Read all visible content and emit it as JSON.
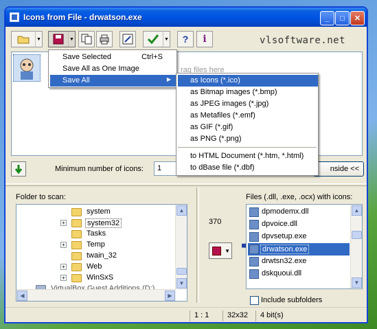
{
  "window": {
    "title": "Icons from File - drwatson.exe",
    "min_glyph": "_",
    "max_glyph": "□",
    "close_glyph": "✕"
  },
  "toolbar": {
    "open_icon": "folder-open-icon",
    "save_icon": "floppy-save-icon",
    "copy_icon": "copy-icon",
    "print_icon": "printer-icon",
    "edit_icon": "edit-icon",
    "select_icon": "checkmark-icon",
    "help_label": "?",
    "info_label": "i",
    "brand": "vlsoftware.net"
  },
  "preview": {
    "hint": "rag files here"
  },
  "controls": {
    "min_icons_label": "Minimum number of icons:",
    "min_icons_value": "1",
    "inside_label": "nside <<"
  },
  "folder_pane": {
    "label": "Folder to scan:",
    "items": [
      {
        "label": "system",
        "expandable": false,
        "selected": false
      },
      {
        "label": "system32",
        "expandable": true,
        "selected": true
      },
      {
        "label": "Tasks",
        "expandable": false,
        "selected": false
      },
      {
        "label": "Temp",
        "expandable": true,
        "selected": false
      },
      {
        "label": "twain_32",
        "expandable": false,
        "selected": false
      },
      {
        "label": "Web",
        "expandable": true,
        "selected": false
      },
      {
        "label": "WinSxS",
        "expandable": true,
        "selected": false
      },
      {
        "label": "VirtualBox Guest Additions (D:)",
        "expandable": true,
        "selected": false
      }
    ]
  },
  "files_pane": {
    "label": "Files (.dll, .exe, .ocx) with icons:",
    "count": "370",
    "items": [
      {
        "label": "dpmodemx.dll",
        "selected": false
      },
      {
        "label": "dpvoice.dll",
        "selected": false
      },
      {
        "label": "dpvsetup.exe",
        "selected": false
      },
      {
        "label": "drwatson.exe",
        "selected": true
      },
      {
        "label": "drwtsn32.exe",
        "selected": false
      },
      {
        "label": "dskquoui.dll",
        "selected": false
      }
    ],
    "include_subfolders": "Include subfolders"
  },
  "status": {
    "ratio": "1 : 1",
    "size": "32x32",
    "depth": "4 bit(s)"
  },
  "save_menu": {
    "items": [
      {
        "label": "Save Selected",
        "shortcut": "Ctrl+S"
      },
      {
        "label": "Save All as One Image",
        "shortcut": ""
      },
      {
        "label": "Save All",
        "shortcut": "",
        "submenu": true
      }
    ]
  },
  "save_all_submenu": {
    "items": [
      "as Icons (*.ico)",
      "as Bitmap images (*.bmp)",
      "as JPEG images (*.jpg)",
      "as Metafiles (*.emf)",
      "as GIF (*.gif)",
      "as PNG (*.png)",
      "to HTML Document (*.htm, *.html)",
      "to dBase file (*.dbf)"
    ]
  }
}
